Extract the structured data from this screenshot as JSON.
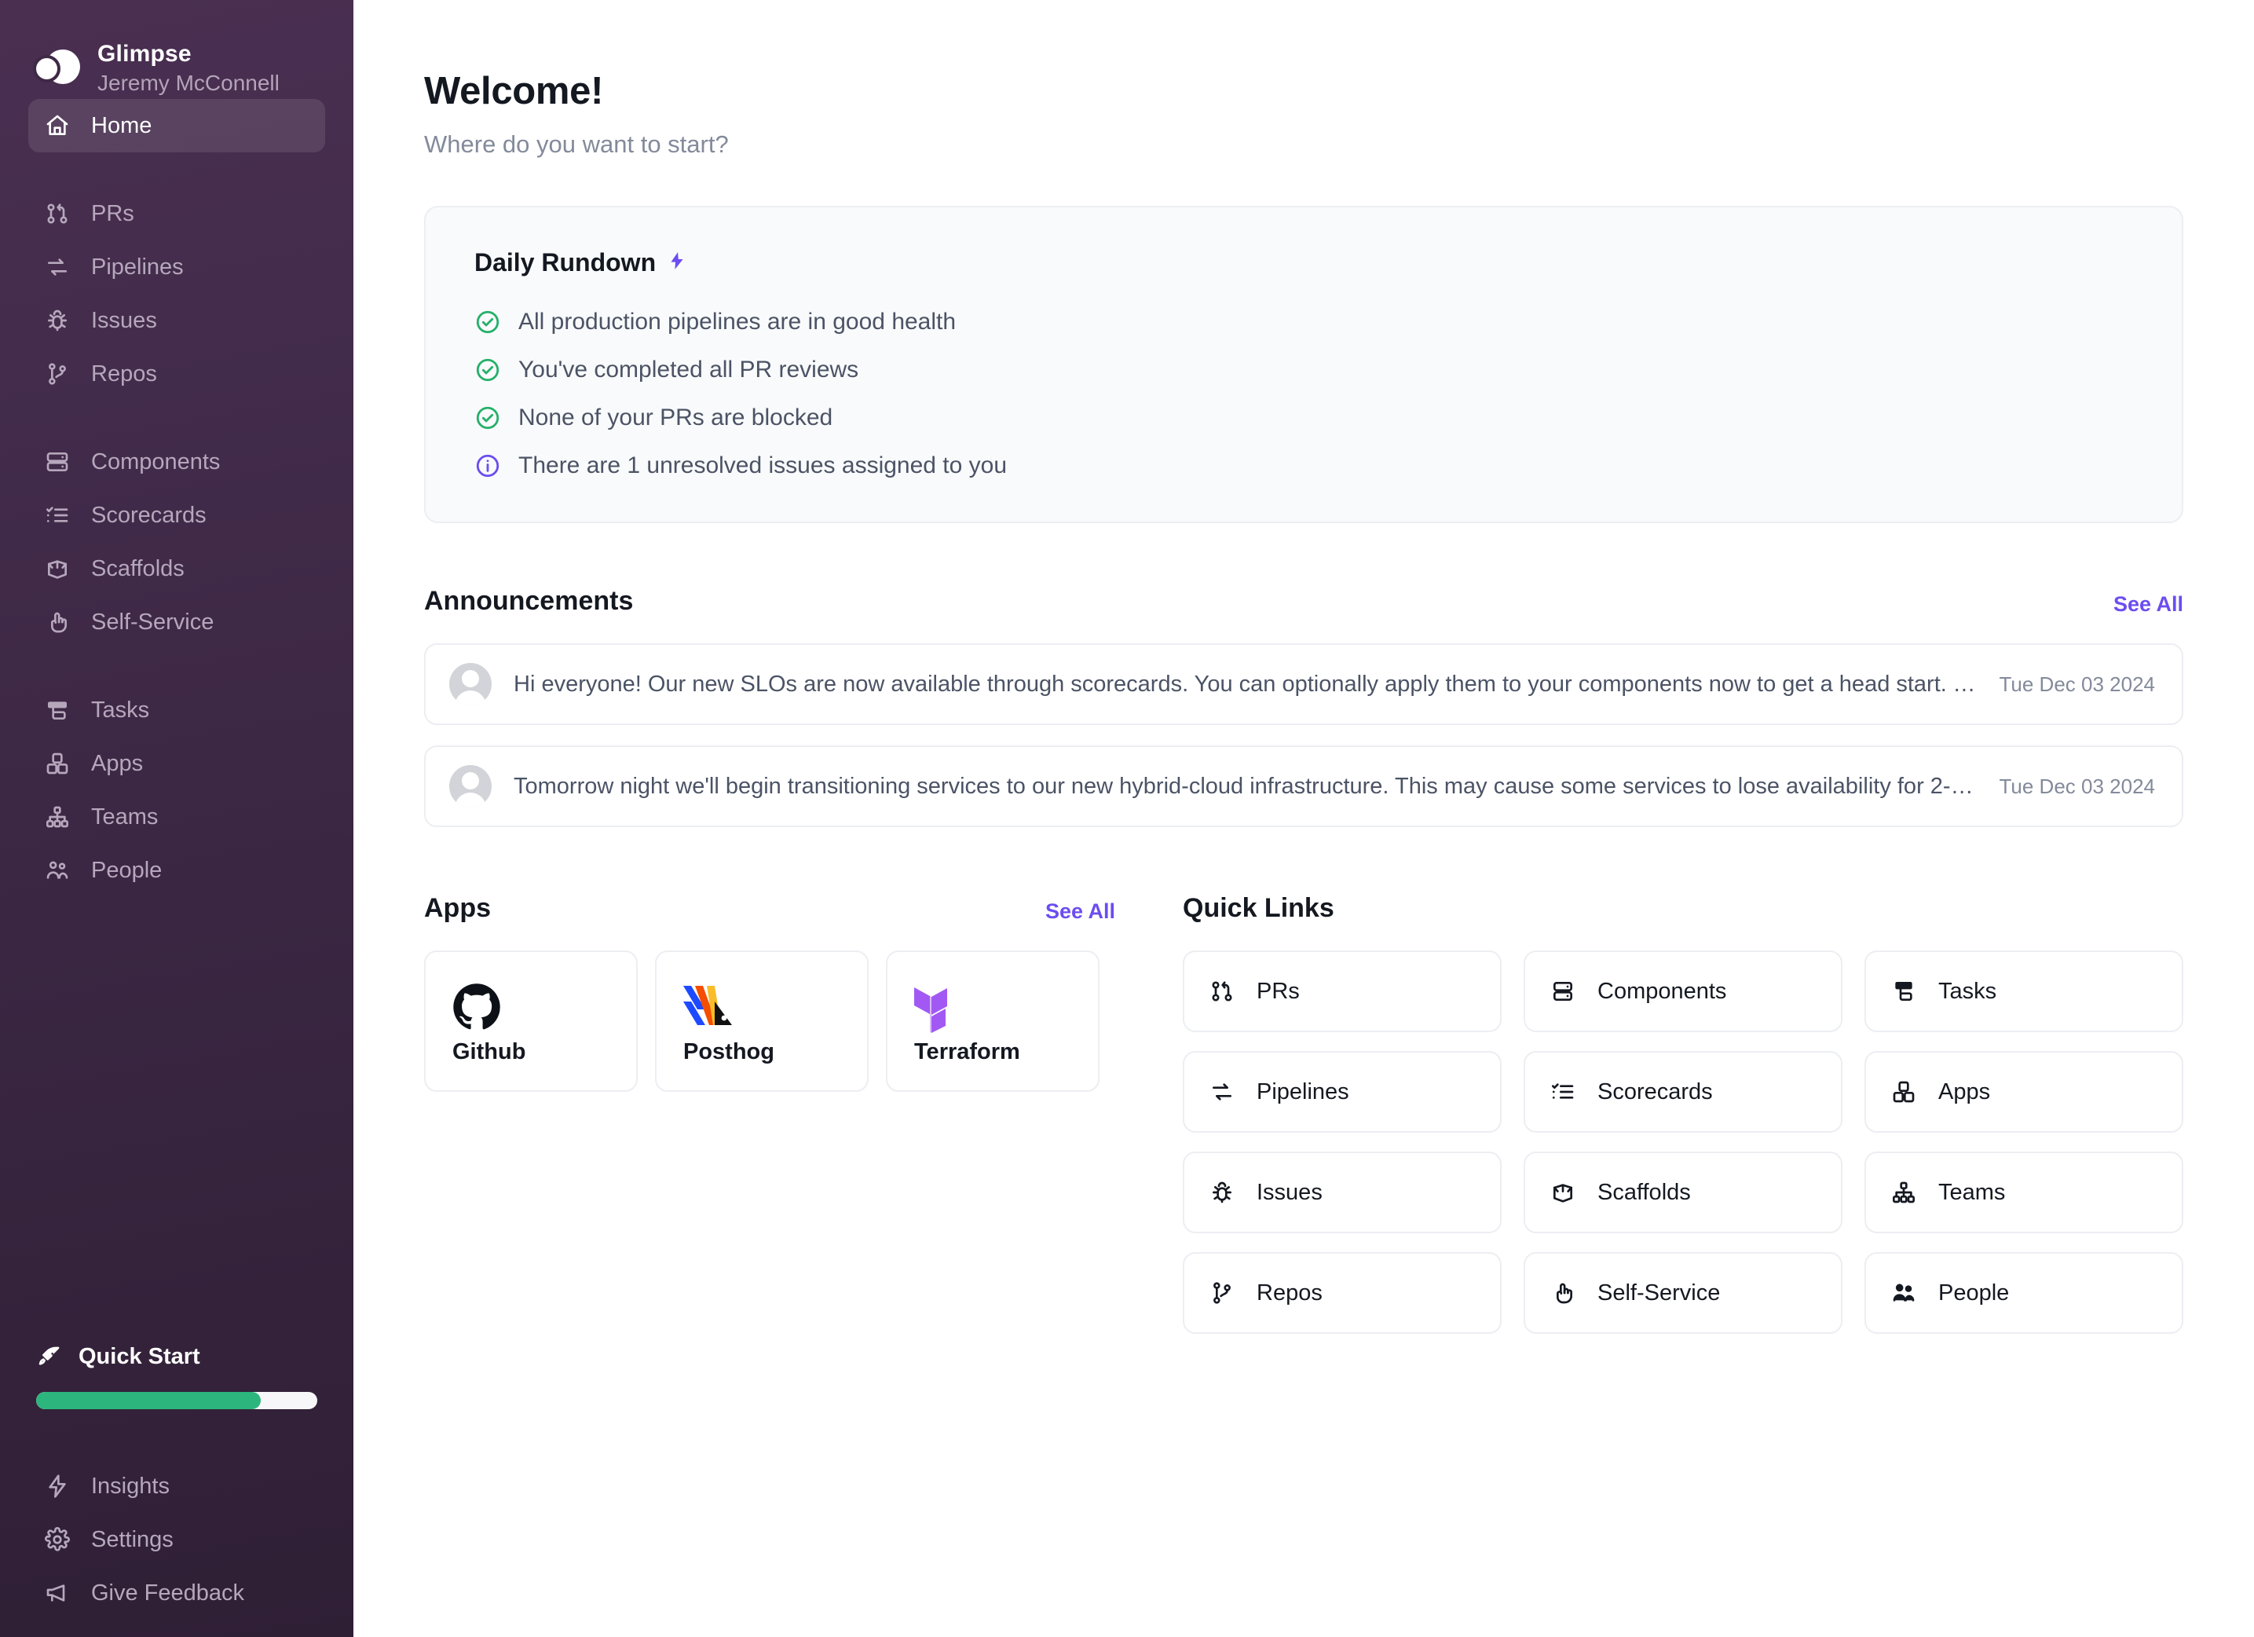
{
  "brand": {
    "name": "Glimpse",
    "user": "Jeremy McConnell",
    "logo_icon": "glimpse-logo"
  },
  "sidebar": {
    "primary": [
      {
        "label": "Home",
        "icon": "home-icon",
        "active": true
      }
    ],
    "group1": [
      {
        "label": "PRs",
        "icon": "pull-request-icon"
      },
      {
        "label": "Pipelines",
        "icon": "pipelines-icon"
      },
      {
        "label": "Issues",
        "icon": "bug-icon"
      },
      {
        "label": "Repos",
        "icon": "git-branch-icon"
      }
    ],
    "group2": [
      {
        "label": "Components",
        "icon": "server-icon"
      },
      {
        "label": "Scorecards",
        "icon": "checklist-icon"
      },
      {
        "label": "Scaffolds",
        "icon": "package-open-icon"
      },
      {
        "label": "Self-Service",
        "icon": "pointer-hand-icon"
      }
    ],
    "group3": [
      {
        "label": "Tasks",
        "icon": "tasks-icon"
      },
      {
        "label": "Apps",
        "icon": "apps-icon"
      },
      {
        "label": "Teams",
        "icon": "org-chart-icon"
      },
      {
        "label": "People",
        "icon": "people-icon"
      }
    ],
    "quick_start": {
      "label": "Quick Start",
      "icon": "rocket-icon",
      "progress_percent": 80,
      "bar_color": "#2cb67d"
    },
    "bottom": [
      {
        "label": "Insights",
        "icon": "lightning-icon"
      },
      {
        "label": "Settings",
        "icon": "gear-icon"
      },
      {
        "label": "Give Feedback",
        "icon": "megaphone-icon"
      }
    ]
  },
  "header": {
    "title": "Welcome!",
    "subtitle": "Where do you want to start?"
  },
  "daily_rundown": {
    "title": "Daily Rundown",
    "badge_icon": "lightning-bolt-icon",
    "items": [
      {
        "text": "All production pipelines are in good health",
        "status": "ok",
        "icon": "check-circle-icon"
      },
      {
        "text": "You've completed all PR reviews",
        "status": "ok",
        "icon": "check-circle-icon"
      },
      {
        "text": "None of your PRs are blocked",
        "status": "ok",
        "icon": "check-circle-icon"
      },
      {
        "text": "There are 1 unresolved issues assigned to you",
        "status": "info",
        "icon": "info-circle-icon"
      }
    ]
  },
  "announcements": {
    "title": "Announcements",
    "see_all": "See All",
    "items": [
      {
        "text": "Hi everyone! Our new SLOs are now available through scorecards. You can optionally apply them to your components now to get a head start. Th…",
        "date": "Tue Dec 03 2024"
      },
      {
        "text": "Tomorrow night we'll begin transitioning services to our new hybrid-cloud infrastructure. This may cause some services to lose availability for 2-…",
        "date": "Tue Dec 03 2024"
      }
    ]
  },
  "apps": {
    "title": "Apps",
    "see_all": "See All",
    "items": [
      {
        "name": "Github",
        "icon": "github-logo"
      },
      {
        "name": "Posthog",
        "icon": "posthog-logo"
      },
      {
        "name": "Terraform",
        "icon": "terraform-logo"
      }
    ]
  },
  "quick_links": {
    "title": "Quick Links",
    "items": [
      {
        "label": "PRs",
        "icon": "pull-request-icon"
      },
      {
        "label": "Components",
        "icon": "server-icon"
      },
      {
        "label": "Tasks",
        "icon": "tasks-icon"
      },
      {
        "label": "Pipelines",
        "icon": "pipelines-icon"
      },
      {
        "label": "Scorecards",
        "icon": "checklist-icon"
      },
      {
        "label": "Apps",
        "icon": "apps-icon"
      },
      {
        "label": "Issues",
        "icon": "bug-icon"
      },
      {
        "label": "Scaffolds",
        "icon": "package-open-icon"
      },
      {
        "label": "Teams",
        "icon": "org-chart-icon"
      },
      {
        "label": "Repos",
        "icon": "git-branch-icon"
      },
      {
        "label": "Self-Service",
        "icon": "pointer-hand-icon"
      },
      {
        "label": "People",
        "icon": "people-icon"
      }
    ]
  },
  "colors": {
    "accent": "#6c4df0",
    "success": "#25b06a",
    "sidebar_top": "#4a2f51",
    "sidebar_bottom": "#2f1f35"
  }
}
